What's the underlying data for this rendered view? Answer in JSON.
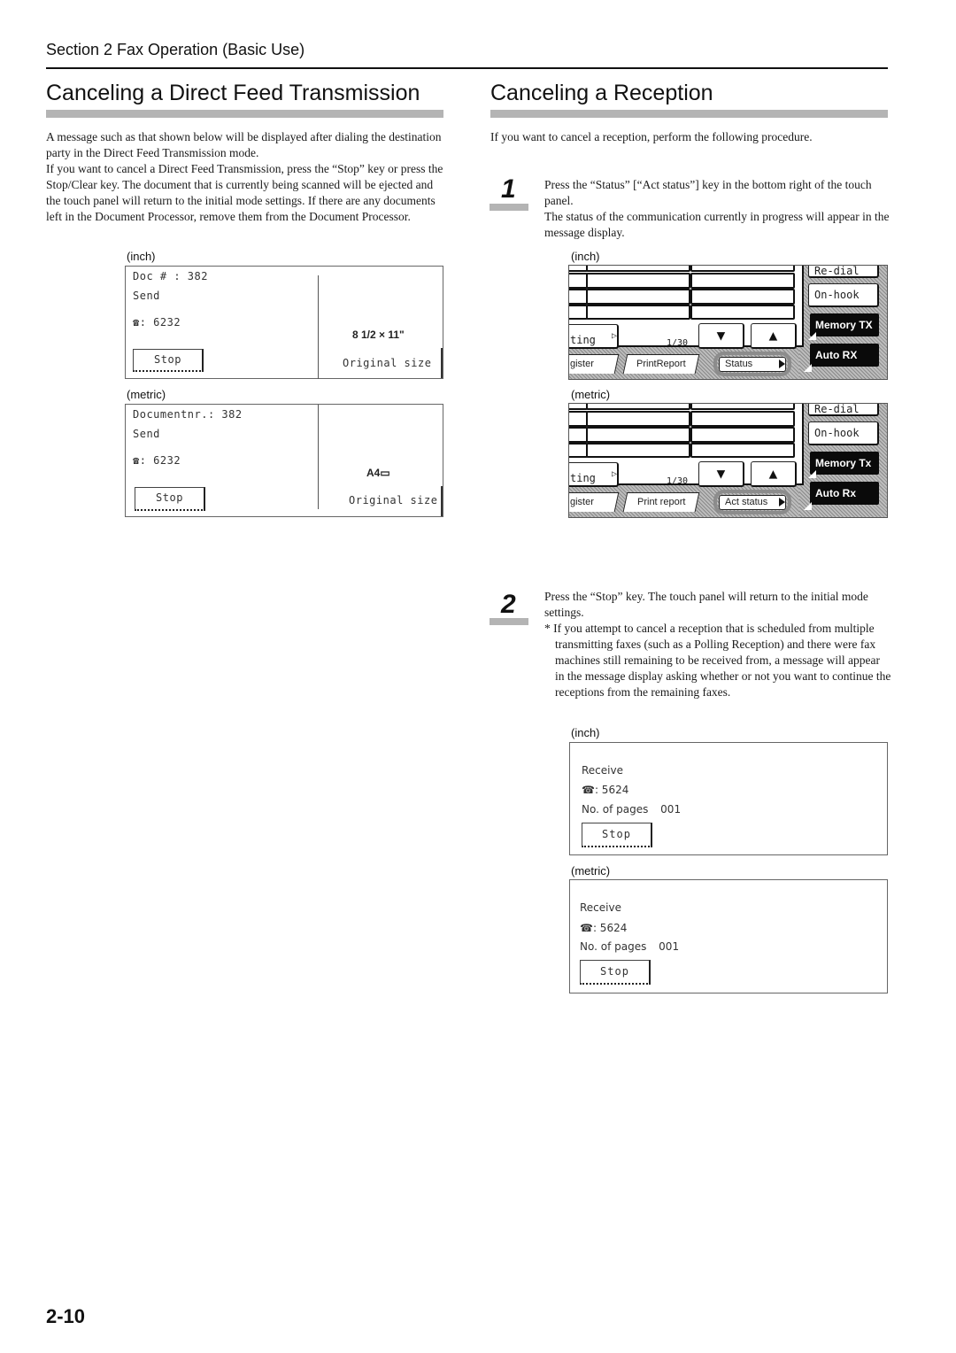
{
  "header": {
    "section": "Section 2  Fax Operation (Basic Use)"
  },
  "left": {
    "title": "Canceling a Direct Feed Transmission",
    "paragraphs": [
      "A message such as that shown below will be displayed after dialing the destination party in the Direct Feed Transmission mode.",
      "If you want to cancel a Direct Feed Transmission, press the “Stop” key or press the Stop/Clear key. The document that is currently being scanned will be ejected and the touch panel will return to the initial mode settings. If there are any documents left in the Document Processor, remove them from the Document Processor."
    ],
    "displays": [
      {
        "unit": "(inch)",
        "doc_line": "Doc # : 382",
        "mode": "Send",
        "phone_icon": "phone-icon",
        "phone_glyph": "☎",
        "phone_number": ": 6232",
        "stop_label": "Stop",
        "size_value": "8 1/2 × 11\"",
        "size_label": "Original size"
      },
      {
        "unit": "(metric)",
        "doc_line": "Documentnr.: 382",
        "mode": "Send",
        "phone_icon": "phone-icon",
        "phone_glyph": "☎",
        "phone_number": ": 6232",
        "stop_label": "Stop",
        "size_value": "A4▭",
        "size_label": "Original size"
      }
    ]
  },
  "right": {
    "title": "Canceling a Reception",
    "intro": "If you want to cancel a reception, perform the following procedure.",
    "steps": [
      {
        "number": "1",
        "lines": [
          "Press the “Status” [“Act status”] key in the bottom right of the touch panel.",
          "The status of the communication currently in progress will appear in the message display."
        ]
      },
      {
        "number": "2",
        "lines": [
          "Press the “Stop” key. The touch panel will return to the initial mode settings."
        ],
        "note": "* If you attempt to cancel a reception that is scheduled from multiple transmitting faxes (such as a Polling Reception) and there were fax machines still remaining to be received from, a message will appear in the message display asking whether or not you want to continue the receptions from the remaining faxes."
      }
    ],
    "touch_panels": [
      {
        "unit": "(inch)",
        "redial": "Re-dial",
        "onhook": "On-hook",
        "memory_tx": "Memory TX",
        "auto_rx": "Auto RX",
        "setting_tab": "ting",
        "page_count": "1/30",
        "down_arrow": "▼",
        "up_arrow": "▲",
        "register_tab": "gister",
        "print_report_tab": "PrintReport",
        "status_key": "Status"
      },
      {
        "unit": "(metric)",
        "redial": "Re-dial",
        "onhook": "On-hook",
        "memory_tx": "Memory Tx",
        "auto_rx": "Auto Rx",
        "setting_tab": "ting",
        "page_count": "1/30",
        "down_arrow": "▼",
        "up_arrow": "▲",
        "register_tab": "gister",
        "print_report_tab": "Print report",
        "status_key": "Act status"
      }
    ],
    "receive_displays": [
      {
        "unit": "(inch)",
        "mode": "Receive",
        "phone_glyph": "☎",
        "phone_number": ": 5624",
        "pages_label": "No. of pages",
        "pages_value": "001",
        "stop_label": "Stop"
      },
      {
        "unit": "(metric)",
        "mode": "Receive",
        "phone_glyph": "☎",
        "phone_number": ": 5624",
        "pages_label": "No. of pages",
        "pages_value": "001",
        "stop_label": "Stop"
      }
    ]
  },
  "footer": {
    "page_number": "2-10"
  },
  "colors": {
    "heading_bar": "#b4b4b4",
    "status_highlight_ring": "#8c8c8c",
    "dark_key": "#0a0a0a"
  }
}
